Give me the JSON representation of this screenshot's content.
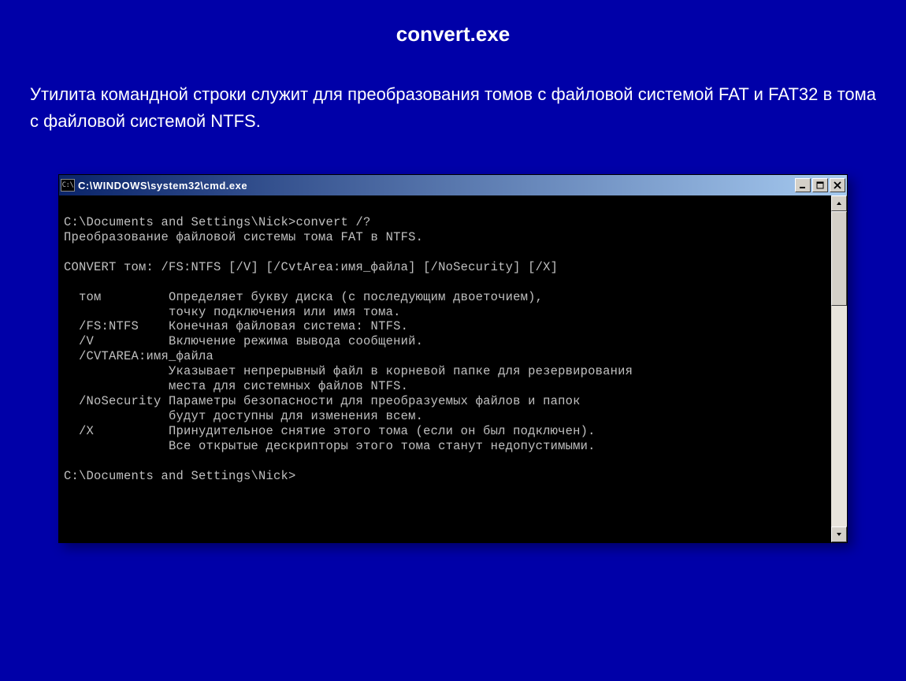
{
  "slide": {
    "title": "convert.exe",
    "description": "Утилита командной строки служит для преобразования томов с файловой системой FAT и FAT32 в тома с файловой системой NTFS."
  },
  "window": {
    "icon_text": "C:\\",
    "title": "C:\\WINDOWS\\system32\\cmd.exe"
  },
  "console": {
    "lines": [
      "",
      "C:\\Documents and Settings\\Nick>convert /?",
      "Преобразование файловой системы тома FAT в NTFS.",
      "",
      "CONVERT том: /FS:NTFS [/V] [/CvtArea:имя_файла] [/NoSecurity] [/X]",
      "",
      "  том         Определяет букву диска (с последующим двоеточием),",
      "              точку подключения или имя тома.",
      "  /FS:NTFS    Конечная файловая система: NTFS.",
      "  /V          Включение режима вывода сообщений.",
      "  /CVTAREA:имя_файла",
      "              Указывает непрерывный файл в корневой папке для резервирования",
      "              места для системных файлов NTFS.",
      "  /NoSecurity Параметры безопасности для преобразуемых файлов и папок",
      "              будут доступны для изменения всем.",
      "  /X          Принудительное снятие этого тома (если он был подключен).",
      "              Все открытые дескрипторы этого тома станут недопустимыми.",
      "",
      "C:\\Documents and Settings\\Nick>"
    ]
  }
}
